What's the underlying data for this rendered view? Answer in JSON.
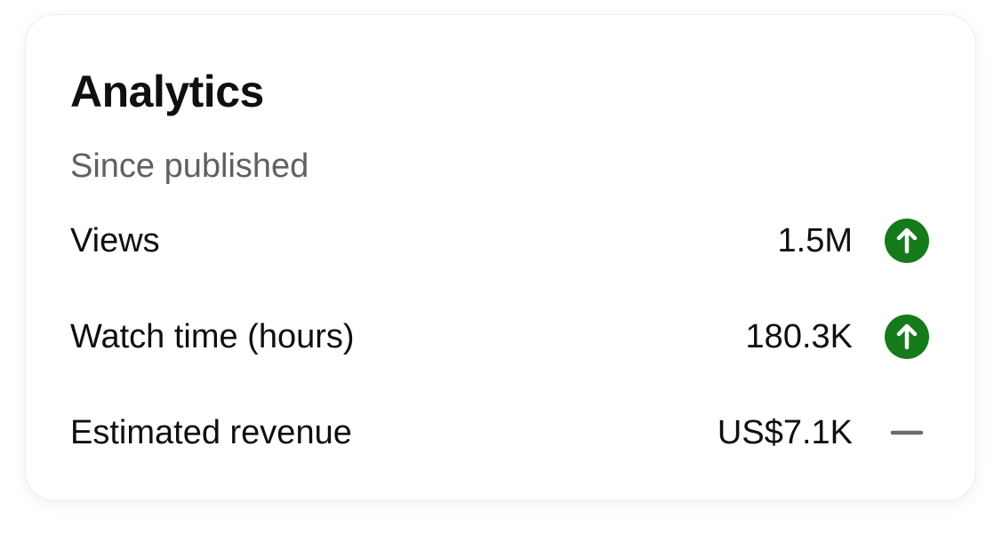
{
  "card": {
    "title": "Analytics",
    "subtitle": "Since published"
  },
  "metrics": [
    {
      "label": "Views",
      "value": "1.5M",
      "trend": "up",
      "trend_icon": "arrow-up-circle-icon"
    },
    {
      "label": "Watch time (hours)",
      "value": "180.3K",
      "trend": "up",
      "trend_icon": "arrow-up-circle-icon"
    },
    {
      "label": "Estimated revenue",
      "value": "US$7.1K",
      "trend": "flat",
      "trend_icon": "dash-icon"
    }
  ],
  "colors": {
    "trend_up": "#157a19",
    "trend_flat": "#6b6b6b",
    "text_primary": "#0f0f0f",
    "text_secondary": "#606060"
  }
}
